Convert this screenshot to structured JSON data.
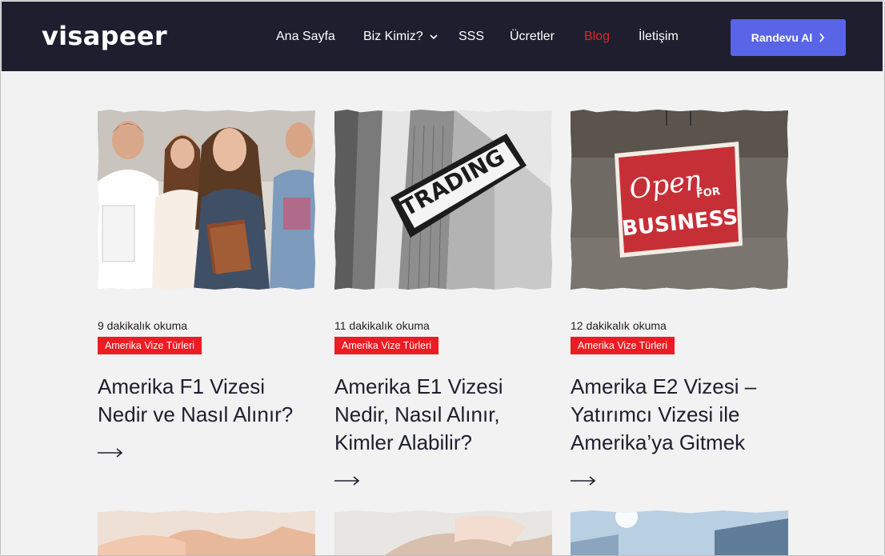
{
  "header": {
    "logo": "visapeer",
    "nav": [
      {
        "label": "Ana Sayfa"
      },
      {
        "label": "Biz Kimiz?"
      },
      {
        "label": "SSS"
      },
      {
        "label": "Ücretler"
      },
      {
        "label": "Blog"
      },
      {
        "label": "İletişim"
      }
    ],
    "cta_label": "Randevu Al"
  },
  "posts": [
    {
      "read_time": "9 dakikalık okuma",
      "category": "Amerika Vize Türleri",
      "title_lines": [
        "Amerika F1 Vizesi",
        "Nedir ve Nasıl Alınır?"
      ]
    },
    {
      "read_time": "11 dakikalık okuma",
      "category": "Amerika Vize Türleri",
      "title_lines": [
        "Amerika E1 Vizesi",
        "Nedir, Nasıl Alınır,",
        "Kimler Alabilir?"
      ],
      "image_text": "TRADING"
    },
    {
      "read_time": "12 dakikalık okuma",
      "category": "Amerika Vize Türleri",
      "title_lines": [
        "Amerika E2 Vizesi –",
        "Yatırımcı Vizesi ile",
        "Amerika’ya Gitmek"
      ],
      "image_text": {
        "line1": "Open",
        "line2": "FOR",
        "line3": "BUSINESS"
      }
    }
  ],
  "colors": {
    "header_bg": "#1f1e2e",
    "accent_red": "#ec1c24",
    "cta_blue": "#5a64e6",
    "page_bg": "#f2f2f2"
  }
}
